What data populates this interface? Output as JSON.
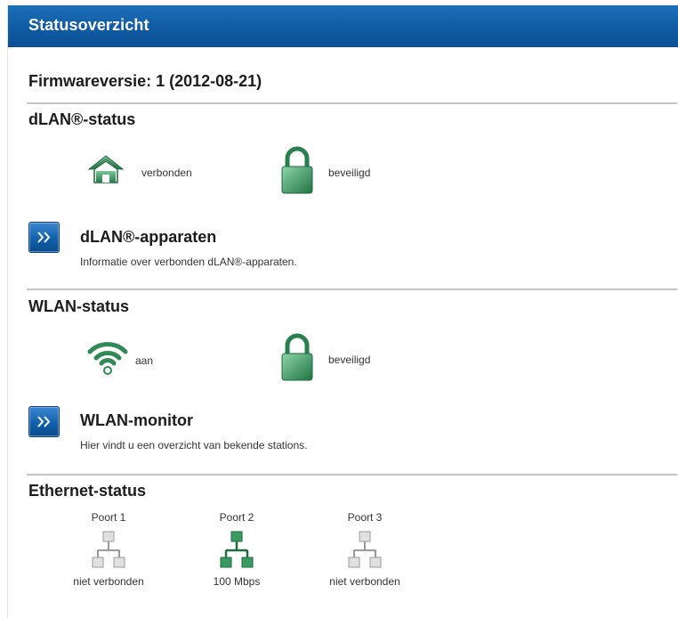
{
  "header": {
    "title": "Statusoverzicht"
  },
  "firmware": {
    "text": "Firmwareversie: 1 (2012-08-21)"
  },
  "dlan_status": {
    "title": "dLAN®-status",
    "connection": {
      "icon": "home-icon",
      "label": "verbonden"
    },
    "security": {
      "icon": "lock-icon",
      "label": "beveiligd"
    }
  },
  "dlan_devices": {
    "title": "dLAN®-apparaten",
    "description": "Informatie over verbonden dLAN®-apparaten.",
    "button_icon": "chevron-double-right-icon"
  },
  "wlan_status": {
    "title": "WLAN-status",
    "radio": {
      "icon": "wifi-icon",
      "label": "aan"
    },
    "security": {
      "icon": "lock-icon",
      "label": "beveiligd"
    }
  },
  "wlan_monitor": {
    "title": "WLAN-monitor",
    "description": "Hier vindt u een overzicht van bekende stations.",
    "button_icon": "chevron-double-right-icon"
  },
  "ethernet_status": {
    "title": "Ethernet-status",
    "ports": [
      {
        "name": "Poort 1",
        "status": "niet verbonden",
        "active": false,
        "icon": "network-port-icon"
      },
      {
        "name": "Poort 2",
        "status": "100 Mbps",
        "active": true,
        "icon": "network-port-icon"
      },
      {
        "name": "Poort 3",
        "status": "niet verbonden",
        "active": false,
        "icon": "network-port-icon"
      }
    ]
  },
  "colors": {
    "header_blue": "#0f5aa2",
    "status_green": "#2f8a55",
    "inactive_gray": "#b8b8b8"
  }
}
